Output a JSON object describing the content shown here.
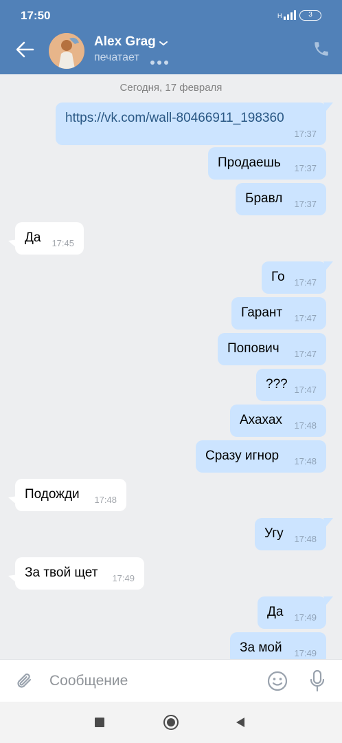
{
  "status": {
    "time": "17:50",
    "battery": "3"
  },
  "header": {
    "name": "Alex Grag",
    "typing": "печатает"
  },
  "chat": {
    "date": "Сегодня, 17 февраля",
    "messages": [
      {
        "dir": "out",
        "text": "https://vk.com/wall-80466911_198360",
        "time": "17:37",
        "link": true
      },
      {
        "dir": "out",
        "text": "Продаешь",
        "time": "17:37"
      },
      {
        "dir": "out",
        "text": "Бравл",
        "time": "17:37"
      },
      {
        "dir": "in",
        "text": "Да",
        "time": "17:45"
      },
      {
        "dir": "out",
        "text": "Го",
        "time": "17:47"
      },
      {
        "dir": "out",
        "text": "Гарант",
        "time": "17:47"
      },
      {
        "dir": "out",
        "text": "Попович",
        "time": "17:47"
      },
      {
        "dir": "out",
        "text": "???",
        "time": "17:47"
      },
      {
        "dir": "out",
        "text": "Ахахах",
        "time": "17:48"
      },
      {
        "dir": "out",
        "text": "Сразу игнор",
        "time": "17:48"
      },
      {
        "dir": "in",
        "text": "Подожди",
        "time": "17:48"
      },
      {
        "dir": "out",
        "text": "Угу",
        "time": "17:48"
      },
      {
        "dir": "in",
        "text": "За твой щет",
        "time": "17:49"
      },
      {
        "dir": "out",
        "text": "Да",
        "time": "17:49"
      },
      {
        "dir": "out",
        "text": "За мой",
        "time": "17:49"
      }
    ]
  },
  "input": {
    "placeholder": "Сообщение"
  },
  "colors": {
    "header": "#5181b8",
    "outgoing": "#cce4ff",
    "incoming": "#ffffff",
    "background": "#edeef0",
    "link": "#2a5885"
  }
}
